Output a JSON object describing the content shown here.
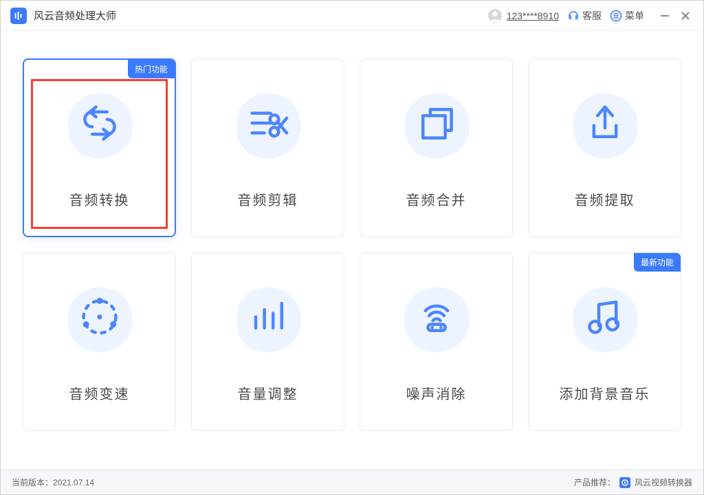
{
  "header": {
    "app_title": "风云音频处理大师",
    "user_name": "123****8910",
    "support_label": "客服",
    "menu_label": "菜单"
  },
  "cards": [
    {
      "label": "音频转换",
      "badge": "热门功能",
      "icon": "convert",
      "active": true,
      "highlighted": true
    },
    {
      "label": "音频剪辑",
      "badge": "",
      "icon": "cut",
      "active": false,
      "highlighted": false
    },
    {
      "label": "音频合并",
      "badge": "",
      "icon": "merge",
      "active": false,
      "highlighted": false
    },
    {
      "label": "音频提取",
      "badge": "",
      "icon": "extract",
      "active": false,
      "highlighted": false
    },
    {
      "label": "音频变速",
      "badge": "",
      "icon": "speed",
      "active": false,
      "highlighted": false
    },
    {
      "label": "音量调整",
      "badge": "",
      "icon": "volume",
      "active": false,
      "highlighted": false
    },
    {
      "label": "噪声消除",
      "badge": "",
      "icon": "denoise",
      "active": false,
      "highlighted": false
    },
    {
      "label": "添加背景音乐",
      "badge": "最新功能",
      "icon": "bgm",
      "active": false,
      "highlighted": false
    }
  ],
  "footer": {
    "version_prefix": "当前版本：",
    "version": "2021.07.14",
    "reco_prefix": "产品推荐：",
    "reco_name": "风云视频转换器"
  }
}
